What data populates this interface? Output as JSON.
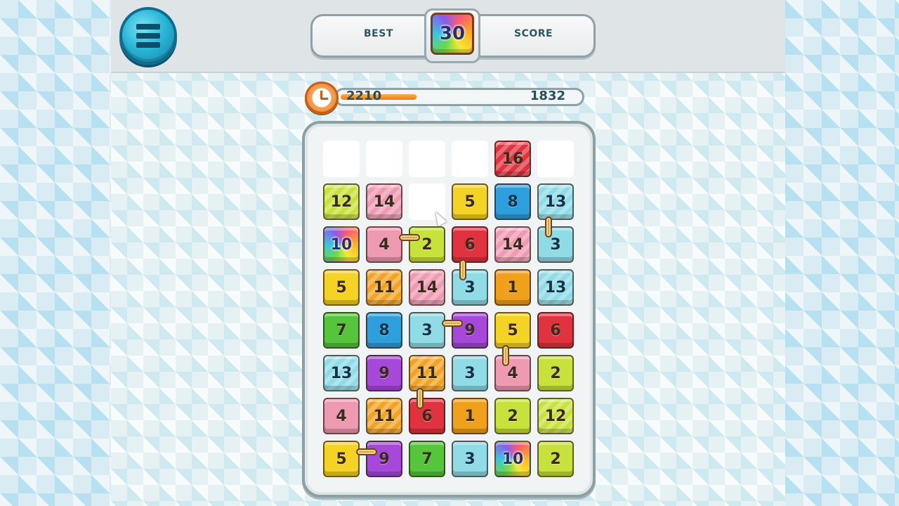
{
  "header": {
    "best_label": "BEST",
    "score_label": "SCORE",
    "goal_value": "30",
    "menu_icon": "hamburger-menu-icon"
  },
  "timer": {
    "icon": "clock-icon",
    "left_value": "2210",
    "right_value": "1832",
    "progress_fraction": 0.32
  },
  "colors": {
    "1": "#f0a11c",
    "2": "#c7e23a",
    "3": "#8fdbe6",
    "4": "#ee9ab3",
    "5": "#f5d324",
    "6": "#e1333f",
    "7": "#55c63b",
    "8": "#2d9fdc",
    "9": "#a648d9",
    "10": "#ffffff",
    "11": "#f2a322",
    "12": "#c7e23a",
    "13": "#8fdbe6",
    "14": "#ee9ab3",
    "16": "#e1333f"
  },
  "board": {
    "rows": [
      [
        null,
        null,
        null,
        null,
        "16",
        null
      ],
      [
        "12",
        "14",
        null,
        "5",
        "8",
        "13"
      ],
      [
        "10",
        "4",
        "2",
        "6",
        "14",
        "3"
      ],
      [
        "5",
        "11",
        "14",
        "3",
        "1",
        "13"
      ],
      [
        "7",
        "8",
        "3",
        "9",
        "5",
        "6"
      ],
      [
        "13",
        "9",
        "11",
        "3",
        "4",
        "2"
      ],
      [
        "4",
        "11",
        "6",
        "1",
        "2",
        "12"
      ],
      [
        "5",
        "9",
        "7",
        "3",
        "10",
        "2"
      ]
    ]
  },
  "chains": [
    {
      "type": "v",
      "row": 1,
      "col": 5,
      "between": "down"
    },
    {
      "type": "h",
      "row": 2,
      "col": 1,
      "between": "right"
    },
    {
      "type": "v",
      "row": 2,
      "col": 3,
      "between": "down"
    },
    {
      "type": "h",
      "row": 4,
      "col": 2,
      "between": "right"
    },
    {
      "type": "v",
      "row": 4,
      "col": 4,
      "between": "down"
    },
    {
      "type": "v",
      "row": 5,
      "col": 2,
      "between": "down"
    },
    {
      "type": "h",
      "row": 7,
      "col": 0,
      "between": "right"
    }
  ]
}
